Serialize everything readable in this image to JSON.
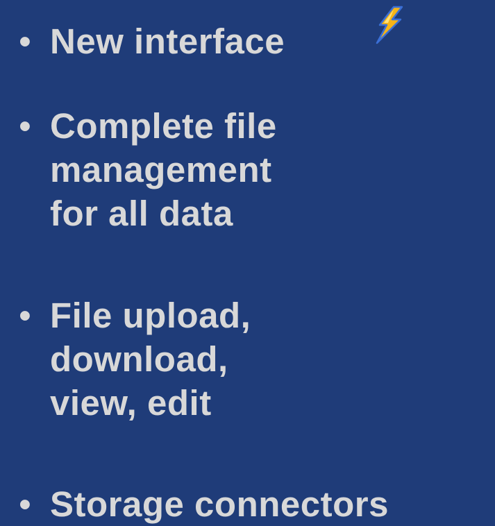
{
  "slide": {
    "bullets": [
      {
        "lines": [
          "New interface"
        ]
      },
      {
        "lines": [
          "Complete file",
          "management",
          "for all data"
        ]
      },
      {
        "lines": [
          "File upload,",
          "download,",
          "view, edit"
        ]
      },
      {
        "lines": [
          "Storage connectors"
        ]
      }
    ],
    "bullet_symbol": "•",
    "decoration_icon": "lightning-bolt-icon",
    "colors": {
      "background": "#1f3c79",
      "text": "#d8d8d8",
      "bolt_fill": "#f5b418",
      "bolt_outline": "#3a6fd6"
    }
  }
}
